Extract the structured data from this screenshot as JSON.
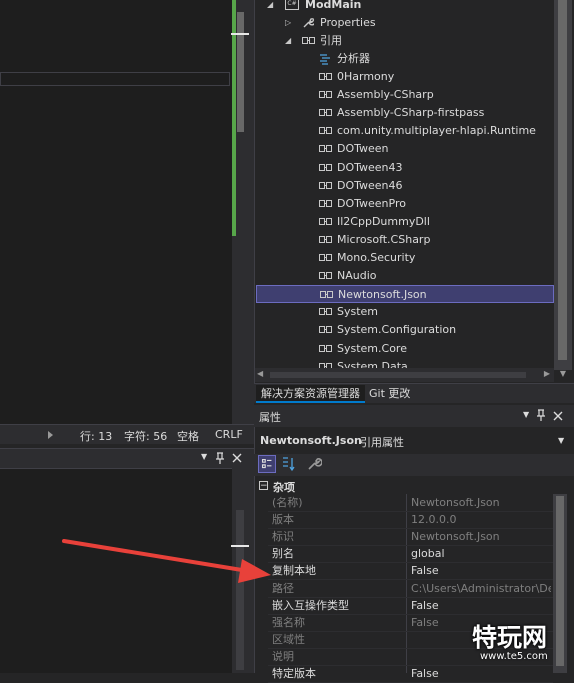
{
  "status_bar": {
    "line": "行: 13",
    "char": "字符: 56",
    "space": "空格",
    "eol": "CRLF"
  },
  "solution_explorer": {
    "project": "ModMain",
    "project_badge": "C#",
    "properties": "Properties",
    "references": "引用",
    "analyzer": "分析器",
    "refs": [
      "0Harmony",
      "Assembly-CSharp",
      "Assembly-CSharp-firstpass",
      "com.unity.multiplayer-hlapi.Runtime",
      "DOTween",
      "DOTween43",
      "DOTween46",
      "DOTweenPro",
      "Il2CppDummyDll",
      "Microsoft.CSharp",
      "Mono.Security",
      "NAudio",
      "Newtonsoft.Json",
      "System",
      "System.Configuration",
      "System.Core",
      "System.Data"
    ],
    "selected": "Newtonsoft.Json"
  },
  "tabs": [
    "解决方案资源管理器",
    "Git 更改"
  ],
  "properties_panel": {
    "title": "属性",
    "object_name": "Newtonsoft.Json",
    "object_type": "引用属性",
    "category": "杂项",
    "rows": [
      {
        "name": "(名称)",
        "value": "Newtonsoft.Json"
      },
      {
        "name": "版本",
        "value": "12.0.0.0"
      },
      {
        "name": "标识",
        "value": "Newtonsoft.Json"
      },
      {
        "name": "别名",
        "value": "global"
      },
      {
        "name": "复制本地",
        "value": "False"
      },
      {
        "name": "路径",
        "value": "C:\\Users\\Administrator\\Des"
      },
      {
        "name": "嵌入互操作类型",
        "value": "False"
      },
      {
        "name": "强名称",
        "value": "False"
      },
      {
        "name": "区域性",
        "value": ""
      },
      {
        "name": "说明",
        "value": ""
      },
      {
        "name": "特定版本",
        "value": "False"
      }
    ]
  },
  "watermark": {
    "brand": "特玩网",
    "url": "www.te5.com"
  },
  "colors": {
    "accent": "#007acc",
    "selection": "#3f3f70",
    "arrow": "#e8413a",
    "green_margin": "#57a64a"
  },
  "icons": {
    "pin": "pin-icon",
    "close": "close-icon",
    "dropdown": "chevron-down-icon",
    "wrench": "wrench-icon",
    "reference": "reference-icon",
    "analyzer": "analyzer-icon"
  }
}
